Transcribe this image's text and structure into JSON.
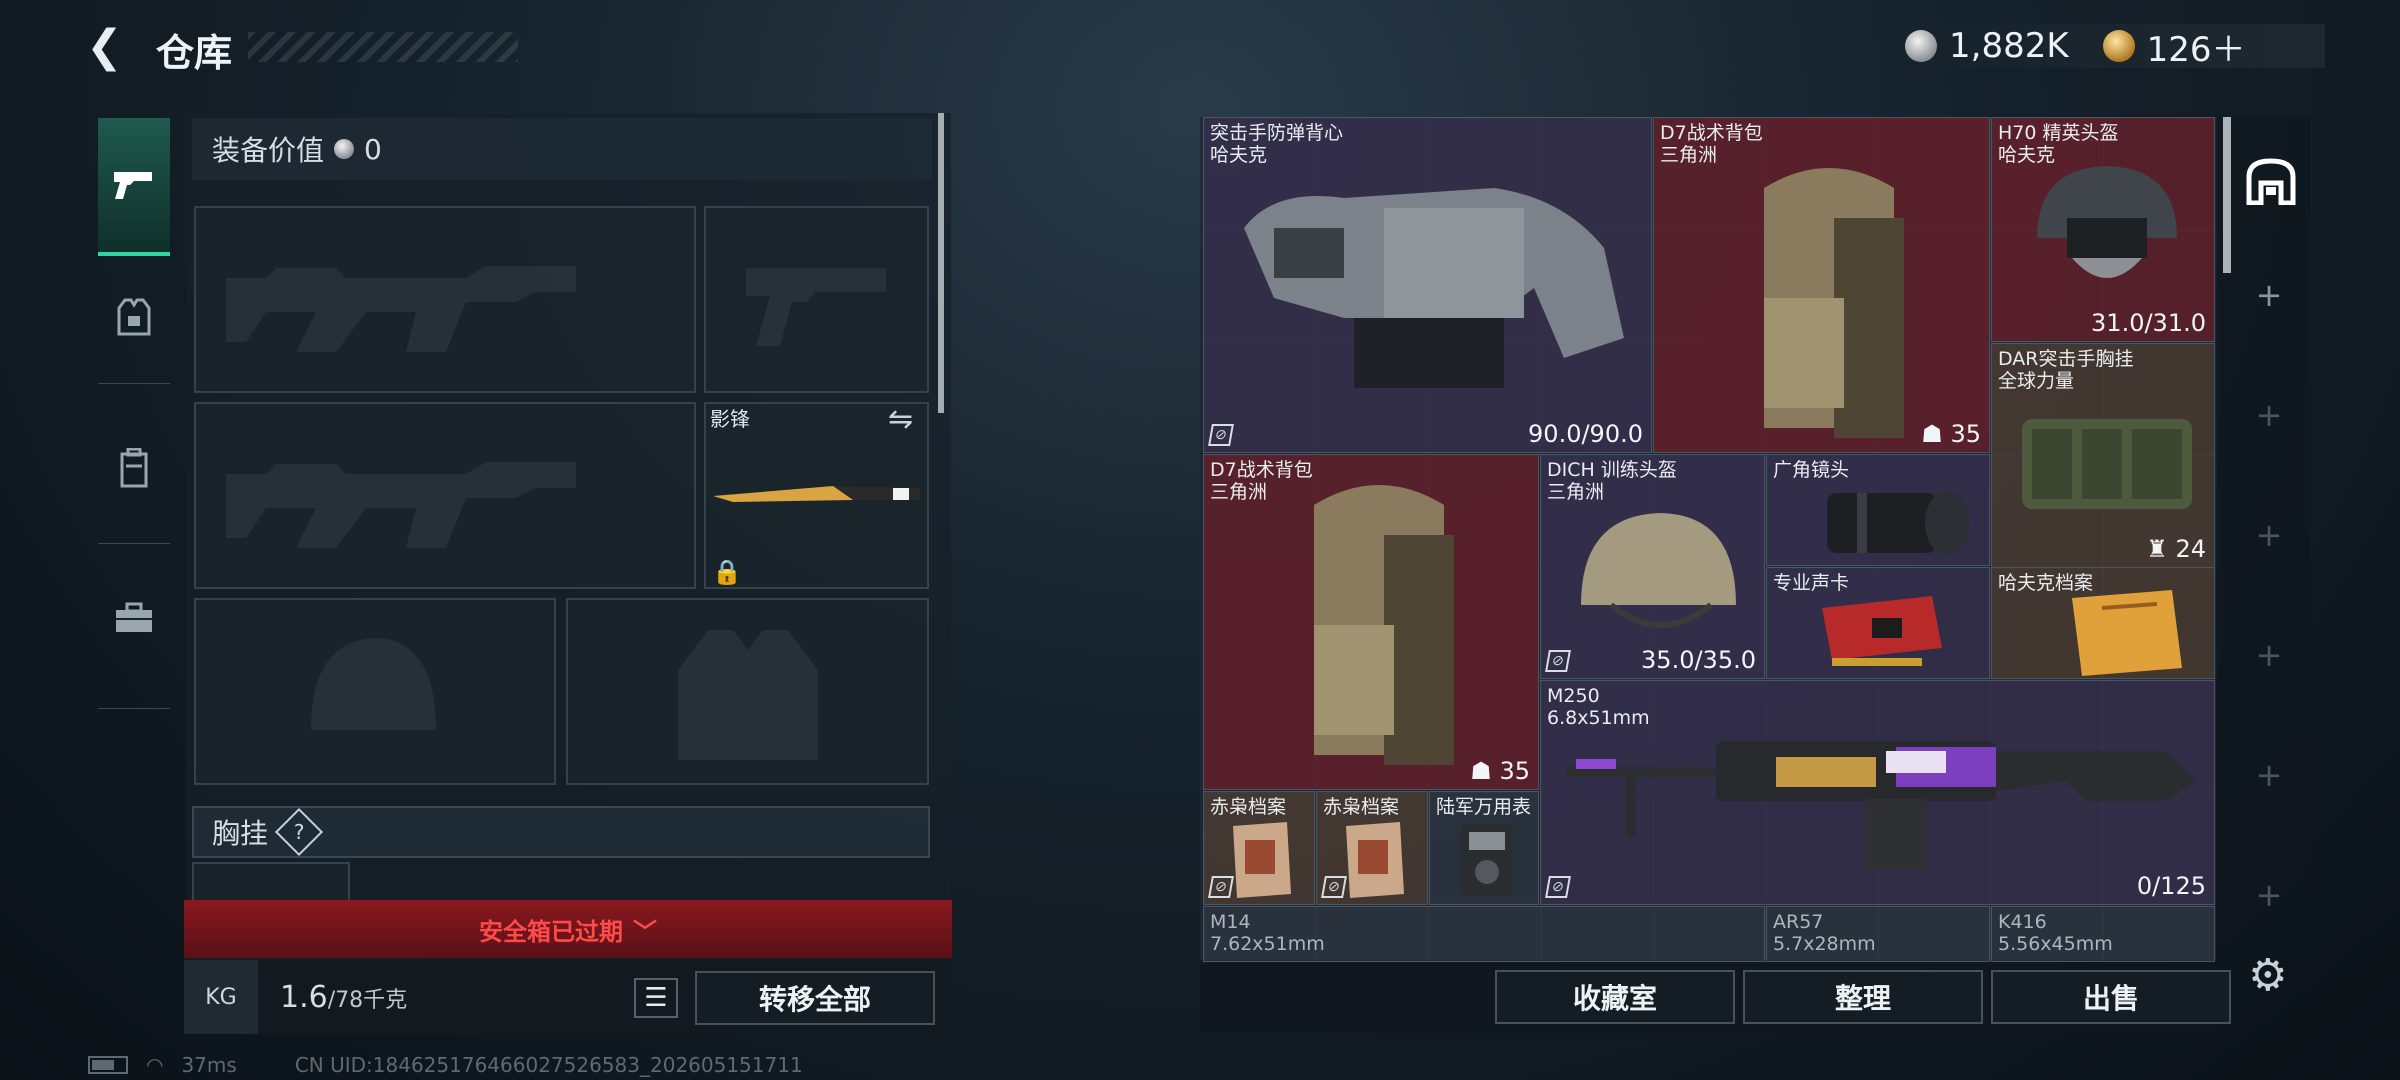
{
  "header": {
    "title": "仓库",
    "silver": "1,882K",
    "gold": "126＋"
  },
  "loadout": {
    "equip_value_label": "装备价值",
    "equip_value": "0",
    "knife_name": "影锋",
    "chest_label": "胸挂",
    "chest_help": "?",
    "safe_box_expired": "安全箱已过期",
    "weight_current": "1.6",
    "weight_capacity": "/78千克",
    "kg_icon": "KG",
    "transfer_all": "转移全部"
  },
  "status_bar": {
    "ping": "37ms",
    "uid": "CN UID:184625176466027526583_202605151711"
  },
  "stash": {
    "items": [
      {
        "name": "突击手防弹背心",
        "sub": "哈夫克",
        "durability": "90.0/90.0"
      },
      {
        "name": "D7战术背包",
        "sub": "三角洲",
        "slots": "35"
      },
      {
        "name": "H70 精英头盔",
        "sub": "哈夫克",
        "durability": "31.0/31.0"
      },
      {
        "name": "DAR突击手胸挂",
        "sub": "全球力量",
        "slots": "24"
      },
      {
        "name": "D7战术背包",
        "sub": "三角洲",
        "slots": "35"
      },
      {
        "name": "DICH 训练头盔",
        "sub": "三角洲",
        "durability": "35.0/35.0"
      },
      {
        "name": "广角镜头"
      },
      {
        "name": "专业声卡"
      },
      {
        "name": "哈夫克档案"
      },
      {
        "name": "M250",
        "sub": "6.8x51mm",
        "ammo": "0/125"
      },
      {
        "name": "赤枭档案"
      },
      {
        "name": "赤枭档案"
      },
      {
        "name": "陆军万用表"
      },
      {
        "name": "M14",
        "sub": "7.62x51mm"
      },
      {
        "name": "AR57",
        "sub": "5.7x28mm"
      },
      {
        "name": "K416",
        "sub": "5.56x45mm"
      }
    ]
  },
  "actions": {
    "collection": "收藏室",
    "sort": "整理",
    "sell": "出售"
  },
  "colors": {
    "accent_green": "#2fd69f",
    "expired_red": "#ff4a4a",
    "rarity_red": "#6e1e28",
    "rarity_purple": "#3a3050",
    "rarity_gold": "#5c4230"
  }
}
